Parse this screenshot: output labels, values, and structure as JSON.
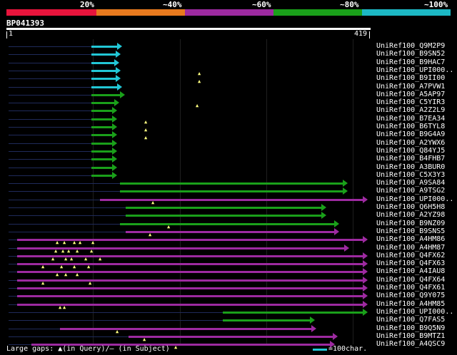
{
  "header": {
    "percent_labels": [
      "20%",
      "~40%",
      "~60%",
      "~80%",
      "~100%"
    ],
    "colors": [
      "#e8143c",
      "#e87a1e",
      "#9d2aa0",
      "#1aa01a",
      "#1cb8c4"
    ]
  },
  "query": {
    "title": "BP041393",
    "start": "1",
    "end": "419"
  },
  "legend": {
    "gaps_text": "Large gaps: ▲(in Query)/– (in Subject)",
    "scale_text": "=100char."
  },
  "hits": [
    {
      "label": "UniRef100_Q9M2P9",
      "color": "#22c7d6"
    },
    {
      "label": "UniRef100_B9SN52",
      "color": "#22c7d6"
    },
    {
      "label": "UniRef100_B9HAC7",
      "color": "#22c7d6"
    },
    {
      "label": "UniRef100_UPI000..",
      "color": "#22c7d6"
    },
    {
      "label": "UniRef100_B9II00",
      "color": "#22c7d6"
    },
    {
      "label": "UniRef100_A7PVW1",
      "color": "#22c7d6"
    },
    {
      "label": "UniRef100_A5AP97",
      "color": "#1aa01a"
    },
    {
      "label": "UniRef100_C5YIR3",
      "color": "#1aa01a"
    },
    {
      "label": "UniRef100_A2Z2L9",
      "color": "#1aa01a"
    },
    {
      "label": "UniRef100_B7EA34",
      "color": "#1aa01a"
    },
    {
      "label": "UniRef100_B6TYL8",
      "color": "#1aa01a"
    },
    {
      "label": "UniRef100_B9G4A9",
      "color": "#1aa01a"
    },
    {
      "label": "UniRef100_A2YWX6",
      "color": "#1aa01a"
    },
    {
      "label": "UniRef100_Q84YJ5",
      "color": "#1aa01a"
    },
    {
      "label": "UniRef100_B4FHB7",
      "color": "#1aa01a"
    },
    {
      "label": "UniRef100_A3BUR0",
      "color": "#1aa01a"
    },
    {
      "label": "UniRef100_C5X3Y3",
      "color": "#1aa01a"
    },
    {
      "label": "UniRef100_A9SA84",
      "color": "#1aa01a"
    },
    {
      "label": "UniRef100_A9TSG2",
      "color": "#1aa01a"
    },
    {
      "label": "UniRef100_UPI000..",
      "color": "#9d2aa0"
    },
    {
      "label": "UniRef100_Q6H5H8",
      "color": "#1aa01a"
    },
    {
      "label": "UniRef100_A2YZ98",
      "color": "#1aa01a"
    },
    {
      "label": "UniRef100_B9NZ09",
      "color": "#1aa01a"
    },
    {
      "label": "UniRef100_B9SNS5",
      "color": "#9d2aa0"
    },
    {
      "label": "UniRef100_A4HM86",
      "color": "#9d2aa0"
    },
    {
      "label": "UniRef100_A4HM87",
      "color": "#9d2aa0"
    },
    {
      "label": "UniRef100_Q4FX62",
      "color": "#9d2aa0"
    },
    {
      "label": "UniRef100_Q4FX63",
      "color": "#9d2aa0"
    },
    {
      "label": "UniRef100_A4IAU8",
      "color": "#9d2aa0"
    },
    {
      "label": "UniRef100_Q4FX64",
      "color": "#9d2aa0"
    },
    {
      "label": "UniRef100_Q4FX61",
      "color": "#9d2aa0"
    },
    {
      "label": "UniRef100_Q9Y075",
      "color": "#9d2aa0"
    },
    {
      "label": "UniRef100_A4HM85",
      "color": "#9d2aa0"
    },
    {
      "label": "UniRef100_UPI000..",
      "color": "#1aa01a"
    },
    {
      "label": "UniRef100_Q7FAS5",
      "color": "#1aa01a"
    },
    {
      "label": "UniRef100_B9Q5N9",
      "color": "#9d2aa0"
    },
    {
      "label": "UniRef100_B9MTZ1",
      "color": "#9d2aa0"
    },
    {
      "label": "UniRef100_A4QSC9",
      "color": "#9d2aa0"
    }
  ]
}
